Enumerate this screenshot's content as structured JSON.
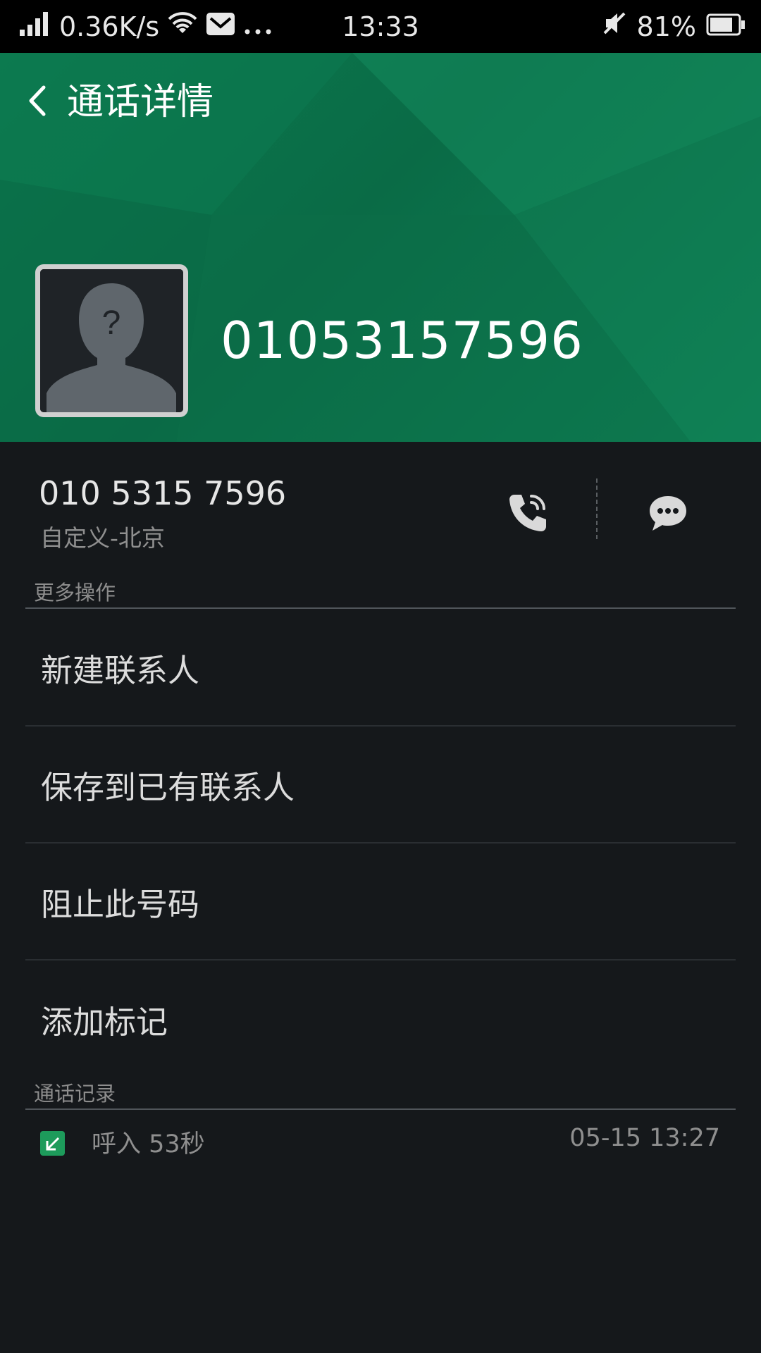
{
  "status_bar": {
    "net_speed": "0.36K/s",
    "time": "13:33",
    "battery": "81%"
  },
  "header": {
    "title": "通话详情",
    "number": "01053157596"
  },
  "contact": {
    "formatted_number": "010 5315 7596",
    "location": "自定义-北京"
  },
  "more_actions": {
    "label": "更多操作",
    "items": [
      {
        "label": "新建联系人"
      },
      {
        "label": "保存到已有联系人"
      },
      {
        "label": "阻止此号码"
      },
      {
        "label": "添加标记"
      }
    ]
  },
  "call_log": {
    "label": "通话记录",
    "entries": [
      {
        "type": "呼入",
        "duration": "53秒",
        "text": "呼入 53秒",
        "datetime": "05-15 13:27"
      }
    ]
  },
  "colors": {
    "header_green": "#0a6b46",
    "background": "#15181b",
    "incoming_icon": "#1d9b5b"
  }
}
